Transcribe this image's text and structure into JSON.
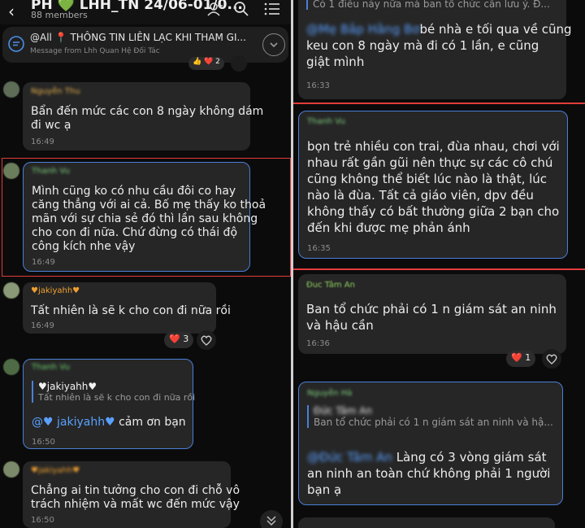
{
  "header": {
    "back_icon": "chevron-left-icon",
    "title": "PH 💚 LHH_TN 24/06-01/0...",
    "members": "88 members"
  },
  "pinned": {
    "title": "@All 📍 THÔNG TIN LIÊN LẠC KHI THAM GI...",
    "subtitle": "Message from Lhh Quan Hệ Đối Tác"
  },
  "left_messages": [
    {
      "sender": "Nguyễn Thu",
      "text_l1": "Bẩn đến mức các con 8 ngày không dám",
      "text_l2": "đi wc ạ",
      "time": "16:49"
    },
    {
      "sender": "Thanh Vu",
      "text_l1": "Mình cũng ko có nhu cầu đôi co hay",
      "text_l2": "căng thẳng với ai cả. Bố mẹ thấy ko thoả",
      "text_l3": "mãn với sự chia sẻ đó thì lần sau không",
      "text_l4": "cho con đi nữa. Chứ đừng  có thái độ",
      "text_l5": "công kích nhe vậy",
      "time": "16:49"
    },
    {
      "sender": "♥jakiyahh♥",
      "text": "Tất nhiên là sẽ k cho con đi nữa rồi",
      "time": "16:49",
      "reaction": "❤️ 3"
    },
    {
      "sender": "Thanh Vu",
      "reply_name": "♥jakiyahh♥",
      "reply_text": "Tất nhiên là sẽ k cho con đi nữa rồi",
      "mention": "@♥ jakiyahh♥",
      "text": " cảm ơn bạn",
      "time": "16:50"
    },
    {
      "sender": "♥jakiyahh♥",
      "text_l1": "Chẳng ai tin tưởng cho con đi chỗ vô",
      "text_l2": "trách nhiệm và mất wc đến mức vậy",
      "time": "16:50"
    }
  ],
  "top_partial": {
    "reaction": "👍 ❤️ 2"
  },
  "right_messages": [
    {
      "reply_text": "Có 1 điều này nữa mà ban tổ chức cần lưu ý. Đ...",
      "mention": "@Mẹ Bắp Hằng Bơ",
      "text_l1": "bé nhà e tối qua về cũng",
      "text_l2": "keu con 8 ngày mà đi có 1 lần, e cũng",
      "text_l3": "giật mình",
      "time": "16:33"
    },
    {
      "sender": "Thanh Vu",
      "text_l1": "bọn trẻ nhiều con trai, đùa nhau, chơi với",
      "text_l2": "nhau rất gần gũi nên thực sự các cô chú",
      "text_l3": "cũng không thể biết lúc nào là thật, lúc",
      "text_l4": "nào là đùa. Tất cả giáo viên, dpv đều",
      "text_l5": "không thấy có bất thường giữa 2 bạn cho",
      "text_l6": "đến khi được mẹ phản ánh",
      "time": "16:35"
    },
    {
      "sender": "Đuc Tâm An",
      "text_l1": "Ban tổ chức phải có 1 n giám sát an ninh",
      "text_l2": "và hậu cần",
      "time": "16:36",
      "reaction": "❤️ 1"
    },
    {
      "sender": "Nguyễn Hà",
      "reply_name": "Đức Tâm An",
      "reply_text": "Ban tổ chức phải có 1 n giám sát an ninh và hậ...",
      "mention": "@Đức Tâm An",
      "text_l1": "Làng có 3 vòng giám sát",
      "text_l2": "an ninh an toàn chứ không phải 1 người",
      "text_l3": "bạn ạ"
    }
  ],
  "colors": {
    "bubble": "#262626",
    "highlight_border": "#4a7fd8",
    "annotation_red": "#e23b3b",
    "mention_blue": "#5aa0ff"
  }
}
